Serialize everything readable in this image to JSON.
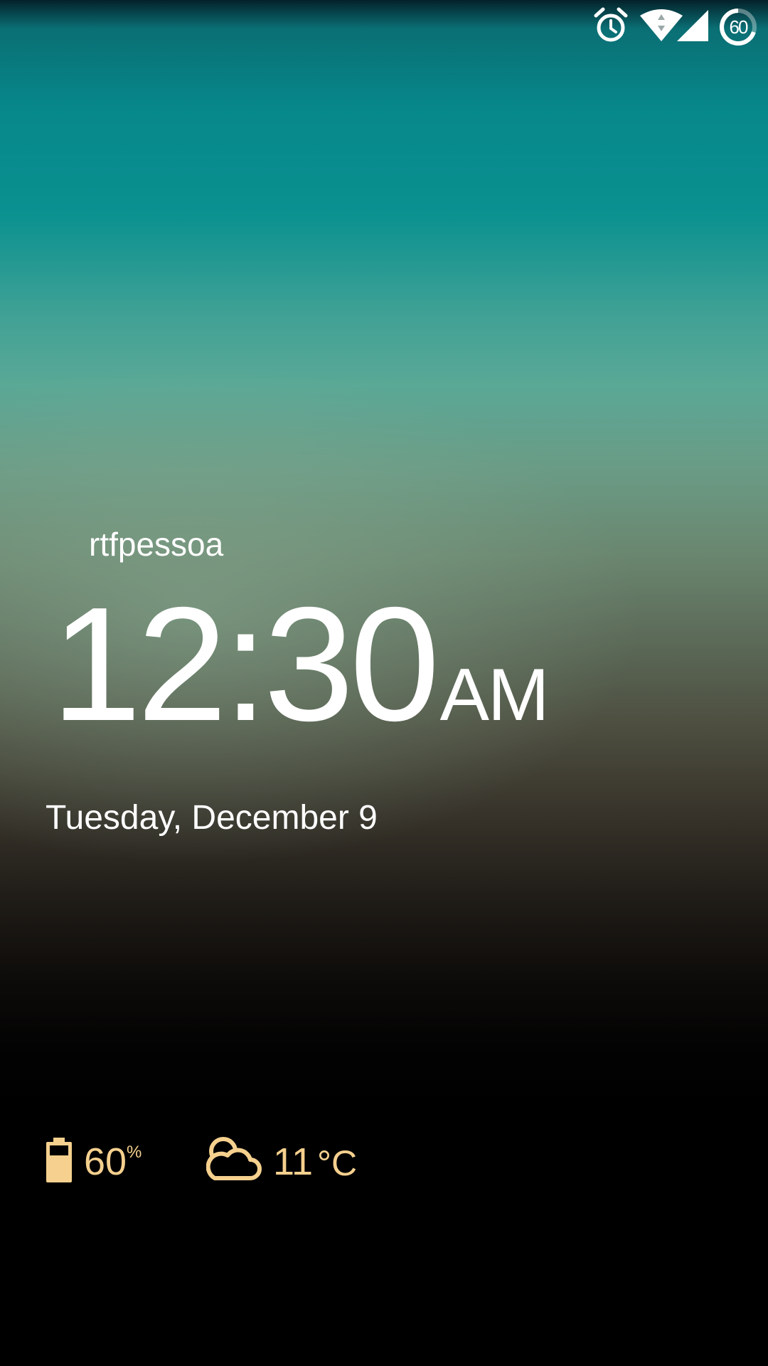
{
  "status_bar": {
    "icons": [
      "alarm-icon",
      "wifi-icon",
      "signal-icon",
      "battery-ring-icon"
    ],
    "battery_level": "60"
  },
  "lockscreen": {
    "owner_info": "rtfpessoa",
    "time": "12:30",
    "ampm": "AM",
    "date": "Tuesday, December 9"
  },
  "widgets": {
    "battery": {
      "icon": "battery-icon",
      "value": "60",
      "unit": "%"
    },
    "weather": {
      "icon": "partly-cloudy-icon",
      "value": "11",
      "unit": "°C"
    }
  },
  "colors": {
    "accent": "#f5d08e",
    "text": "#ffffff"
  }
}
